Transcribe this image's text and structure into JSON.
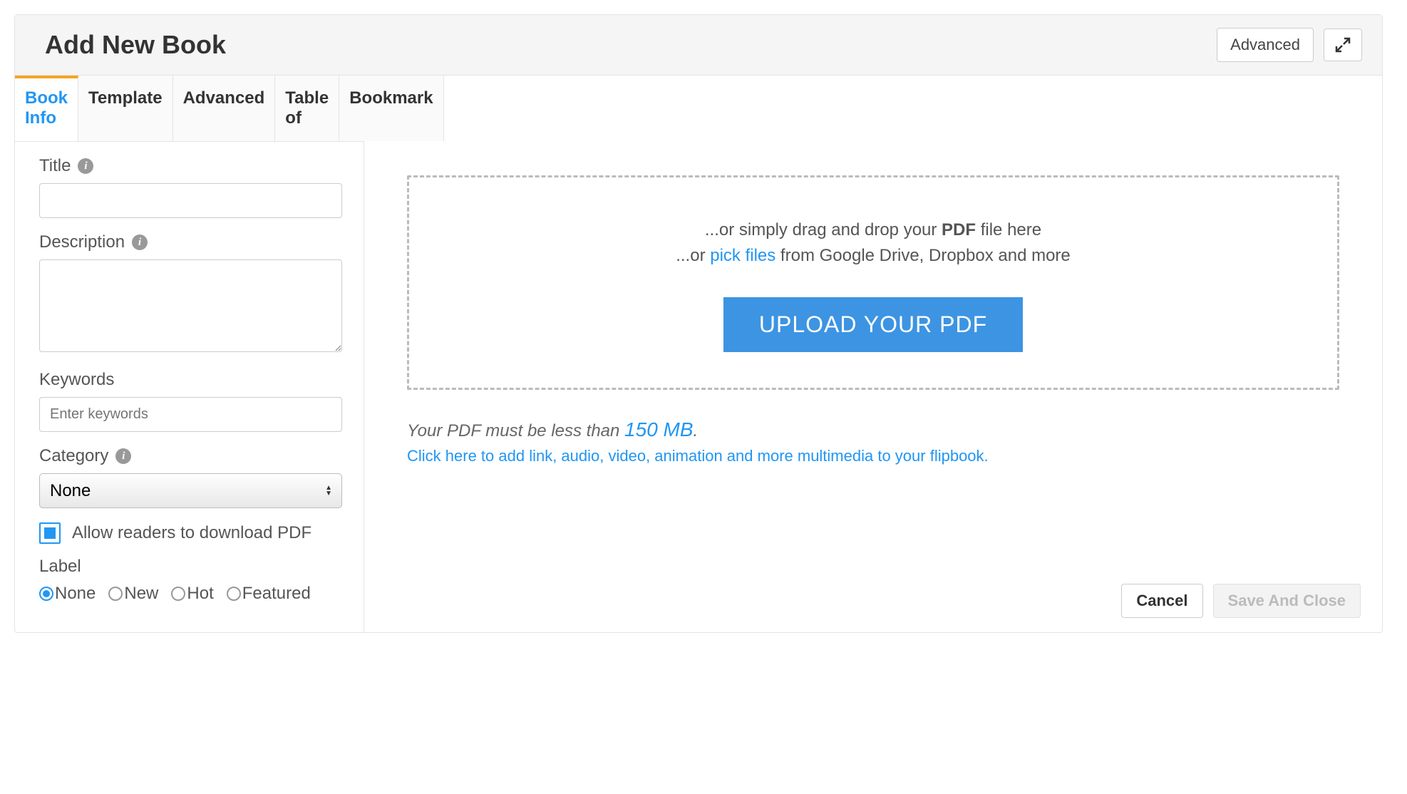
{
  "header": {
    "title": "Add New Book",
    "advanced_btn": "Advanced"
  },
  "tabs": [
    "Book Info",
    "Template",
    "Advanced",
    "Table of",
    "Bookmark"
  ],
  "form": {
    "title_label": "Title",
    "title_value": "",
    "description_label": "Description",
    "description_value": "",
    "keywords_label": "Keywords",
    "keywords_placeholder": "Enter keywords",
    "keywords_value": "",
    "category_label": "Category",
    "category_selected": "None",
    "allow_download_label": "Allow readers to download PDF",
    "allow_download_checked": true,
    "label_label": "Label",
    "label_options": [
      "None",
      "New",
      "Hot",
      "Featured"
    ],
    "label_selected": "None"
  },
  "dropzone": {
    "line1_prefix": "...or simply drag and drop your ",
    "line1_bold": "PDF",
    "line1_suffix": " file here",
    "line2_prefix": "...or ",
    "line2_link": "pick files",
    "line2_suffix": " from Google Drive, Dropbox and more",
    "upload_btn": "UPLOAD YOUR PDF"
  },
  "hints": {
    "size_prefix": "Your PDF must be less than ",
    "size_value": "150 MB",
    "size_suffix": ".",
    "multimedia_link": "Click here to add link, audio, video, animation and more multimedia to your flipbook."
  },
  "footer": {
    "cancel": "Cancel",
    "save": "Save And Close"
  }
}
